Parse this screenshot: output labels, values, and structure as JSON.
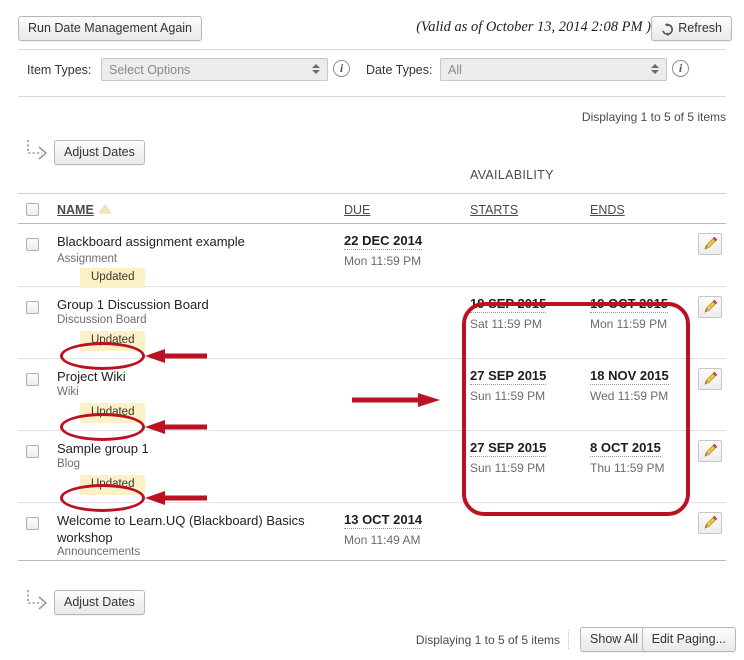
{
  "toolbar": {
    "run_again_label": "Run Date Management Again",
    "valid_as_of": "(Valid as of October 13, 2014 2:08 PM )",
    "refresh_label": "Refresh",
    "refresh_icon": "refresh-icon"
  },
  "filters": {
    "item_types_label": "Item Types:",
    "item_types_value": "Select Options",
    "date_types_label": "Date Types:",
    "date_types_value": "All",
    "info_icon": "info-icon",
    "info_glyph": "i"
  },
  "paging": {
    "displaying_top": "Displaying 1 to 5 of 5 items",
    "displaying_bottom": "Displaying 1 to 5 of 5 items",
    "show_all_label": "Show All",
    "edit_paging_label": "Edit Paging..."
  },
  "actions": {
    "adjust_dates_label": "Adjust Dates",
    "branch_icon": "branch-arrow-icon",
    "edit_icon": "pencil-icon"
  },
  "table": {
    "group_header": "AVAILABILITY",
    "columns": {
      "name": "NAME",
      "due": "DUE",
      "starts": "STARTS",
      "ends": "ENDS"
    },
    "sort_icon": "sort-ascending-triangle-icon",
    "rows": [
      {
        "name": "Blackboard assignment example",
        "type": "Assignment",
        "badge": "Updated",
        "due_date": "22 DEC 2014",
        "due_time": "Mon 11:59 PM",
        "starts_date": "",
        "starts_time": "",
        "ends_date": "",
        "ends_time": ""
      },
      {
        "name": "Group 1 Discussion Board",
        "type": "Discussion Board",
        "badge": "Updated",
        "due_date": "",
        "due_time": "",
        "starts_date": "19 SEP 2015",
        "starts_time": "Sat 11:59 PM",
        "ends_date": "19 OCT 2015",
        "ends_time": "Mon 11:59 PM"
      },
      {
        "name": "Project Wiki",
        "type": "Wiki",
        "badge": "Updated",
        "due_date": "",
        "due_time": "",
        "starts_date": "27 SEP 2015",
        "starts_time": "Sun 11:59 PM",
        "ends_date": "18 NOV 2015",
        "ends_time": "Wed 11:59 PM"
      },
      {
        "name": "Sample group 1",
        "type": "Blog",
        "badge": "Updated",
        "due_date": "",
        "due_time": "",
        "starts_date": "27 SEP 2015",
        "starts_time": "Sun 11:59 PM",
        "ends_date": "8 OCT 2015",
        "ends_time": "Thu 11:59 PM"
      },
      {
        "name": "Welcome to Learn.UQ (Blackboard) Basics workshop",
        "type": "Announcements",
        "badge": "",
        "due_date": "13 OCT 2014",
        "due_time": "Mon 11:49 AM",
        "starts_date": "",
        "starts_time": "",
        "ends_date": "",
        "ends_time": ""
      }
    ]
  },
  "annotations": {
    "color": "#bb1122",
    "highlight_badge_rows": [
      "Group 1 Discussion Board",
      "Project Wiki",
      "Sample group 1"
    ],
    "highlight_region": "availability-dates"
  }
}
